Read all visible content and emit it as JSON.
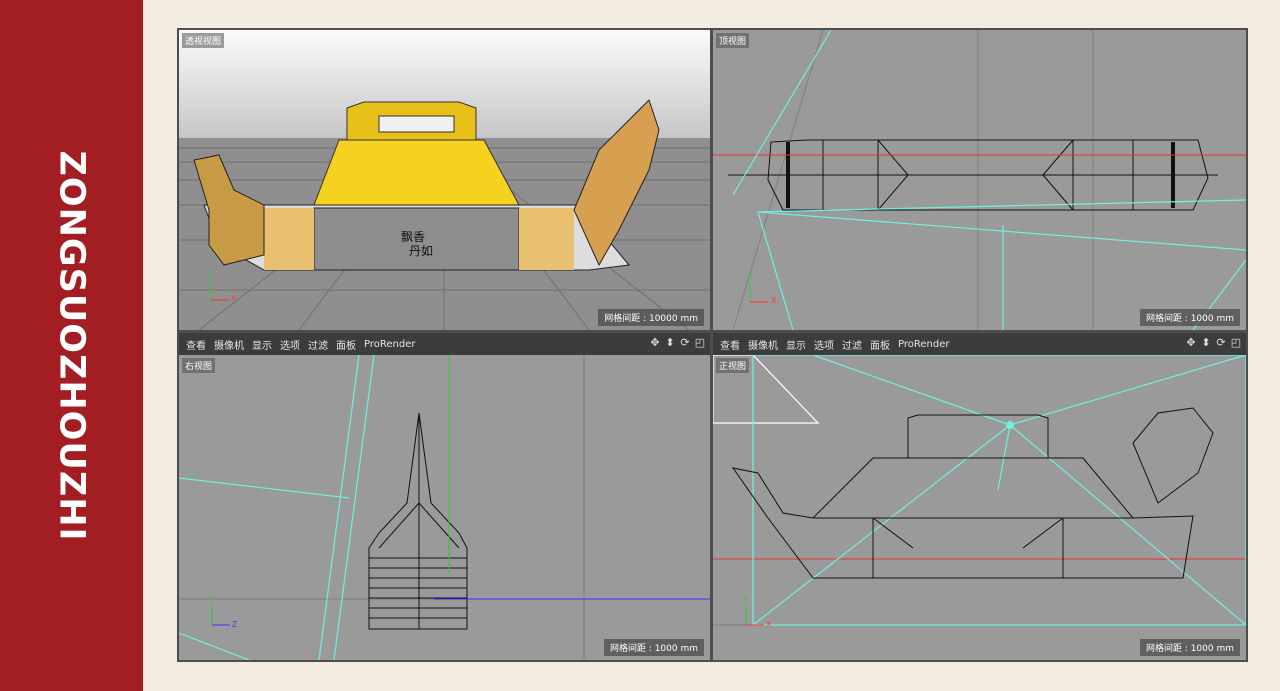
{
  "brand": {
    "vertical_text": "ZONGSUOZHOUZHI",
    "color": "#a31e22"
  },
  "viewports": [
    {
      "label": "透视视图",
      "grid": "网格间距 : 10000 mm"
    },
    {
      "label": "顶视图",
      "grid": "网格间距 : 1000 mm"
    },
    {
      "label": "右视图",
      "grid": "网格间距 : 1000 mm"
    },
    {
      "label": "正视图",
      "grid": "网格间距 : 1000 mm"
    }
  ],
  "menu": [
    "查看",
    "摄像机",
    "显示",
    "选项",
    "过滤",
    "面板",
    "ProRender"
  ],
  "model_text": [
    "飘香",
    "丹如"
  ],
  "axis_labels": {
    "y": "Y",
    "x": "X",
    "z": "Z"
  },
  "icons": [
    "move-icon",
    "arrow-icon",
    "rotate-icon",
    "maximize-icon"
  ]
}
